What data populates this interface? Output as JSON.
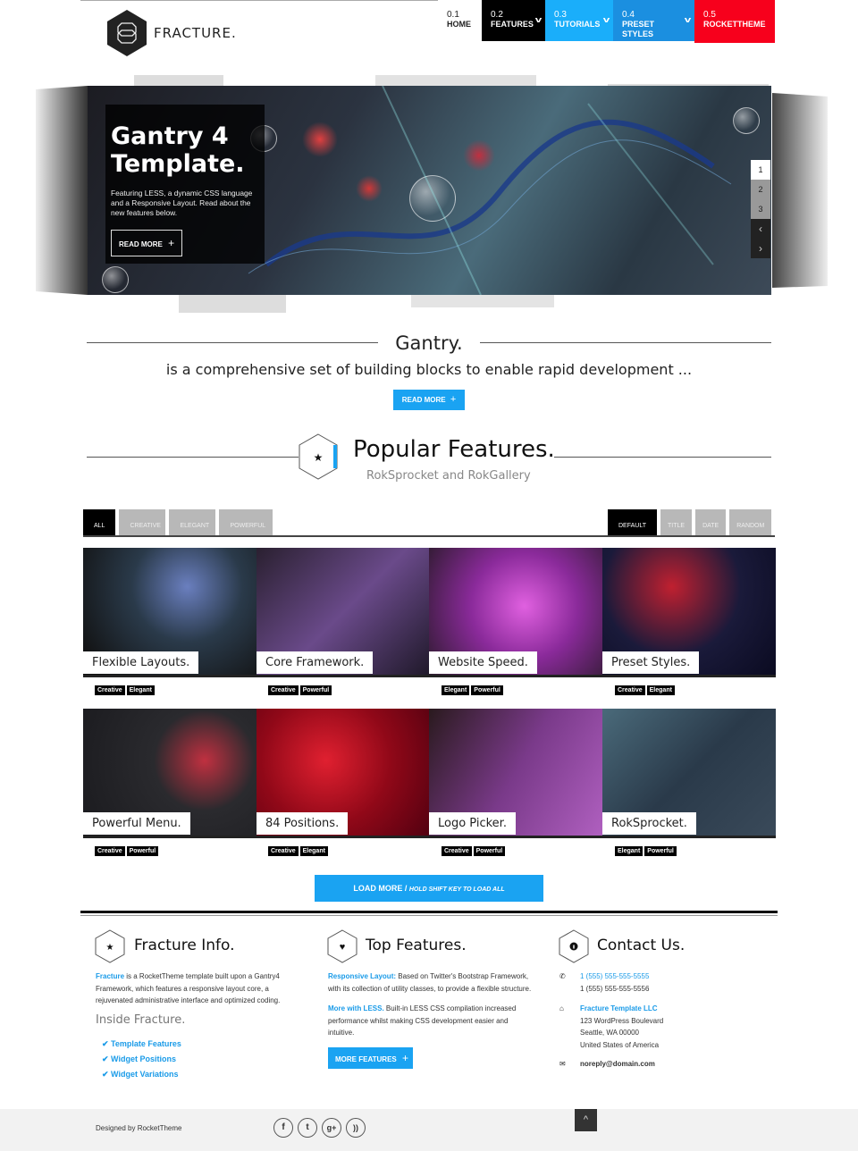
{
  "header": {
    "logo_text": "FRACTURE.",
    "nav": [
      {
        "num": "0.1",
        "label": "HOME",
        "has_dropdown": false
      },
      {
        "num": "0.2",
        "label": "FEATURES",
        "has_dropdown": true
      },
      {
        "num": "0.3",
        "label": "TUTORIALS",
        "has_dropdown": true
      },
      {
        "num": "0.4",
        "label": "PRESET STYLES",
        "has_dropdown": true
      },
      {
        "num": "0.5",
        "label": "ROCKETTHEME",
        "has_dropdown": false
      }
    ],
    "colors": {
      "features": "#000000",
      "tutorials": "#1aaefa",
      "preset": "#1b8fe0",
      "rockettheme": "#f7001c"
    }
  },
  "slider": {
    "title_line1": "Gantry 4",
    "title_line2": "Template.",
    "text": "Featuring LESS, a dynamic CSS language and a Responsive Layout. Read about the new features below.",
    "button": "READ MORE",
    "pages": [
      "1",
      "2",
      "3"
    ],
    "active_page": "1",
    "prev": "‹",
    "next": "›"
  },
  "gantry": {
    "title": "Gantry.",
    "subtitle": "is a comprehensive set of building blocks to enable rapid development ...",
    "button": "READ MORE"
  },
  "popular": {
    "title": "Popular Features.",
    "subtitle": "RokSprocket and RokGallery",
    "filters": [
      "ALL",
      "CREATIVE",
      "ELEGANT",
      "POWERFUL"
    ],
    "active_filter": "ALL",
    "sorts": [
      "DEFAULT",
      "TITLE",
      "DATE",
      "RANDOM"
    ],
    "active_sort": "DEFAULT",
    "items": [
      {
        "title": "Flexible Layouts.",
        "tags": [
          "Creative",
          "Elegant"
        ]
      },
      {
        "title": "Core Framework.",
        "tags": [
          "Creative",
          "Powerful"
        ]
      },
      {
        "title": "Website Speed.",
        "tags": [
          "Elegant",
          "Powerful"
        ]
      },
      {
        "title": "Preset Styles.",
        "tags": [
          "Creative",
          "Elegant"
        ]
      },
      {
        "title": "Powerful Menu.",
        "tags": [
          "Creative",
          "Powerful"
        ]
      },
      {
        "title": "84 Positions.",
        "tags": [
          "Creative",
          "Elegant"
        ]
      },
      {
        "title": "Logo Picker.",
        "tags": [
          "Creative",
          "Powerful"
        ]
      },
      {
        "title": "RokSprocket.",
        "tags": [
          "Elegant",
          "Powerful"
        ]
      }
    ],
    "load_more": "LOAD MORE /",
    "load_more_hint": "HOLD SHIFT KEY TO LOAD ALL"
  },
  "footer": {
    "info": {
      "title": "Fracture Info.",
      "link": "Fracture",
      "text": " is a RocketTheme template built upon a Gantry4 Framework, which features a responsive layout core, a rejuvenated administrative interface and optimized coding.",
      "inside_title": "Inside Fracture.",
      "links": [
        "Template Features",
        "Widget Positions",
        "Widget Variations"
      ]
    },
    "top": {
      "title": "Top Features.",
      "p1_link": "Responsive Layout:",
      "p1_text": " Based on Twitter's Bootstrap Framework, with its collection of utility classes, to provide a flexible structure.",
      "p2_link": "More with LESS.",
      "p2_text": " Built-in LESS CSS compilation increased performance whilst making CSS development easier and intuitive.",
      "button": "MORE FEATURES"
    },
    "contact": {
      "title": "Contact Us.",
      "phone1": "1 (555) 555-555-5555",
      "phone2": "1 (555) 555-555-5556",
      "company": "Fracture Template LLC",
      "address1": "123 WordPress Boulevard",
      "address2": "Seattle, WA 00000",
      "address3": "United States of America",
      "email": "noreply@domain.com"
    },
    "designed_by": "Designed by RocketTheme",
    "social": [
      "f",
      "t",
      "g+",
      "rss"
    ]
  }
}
